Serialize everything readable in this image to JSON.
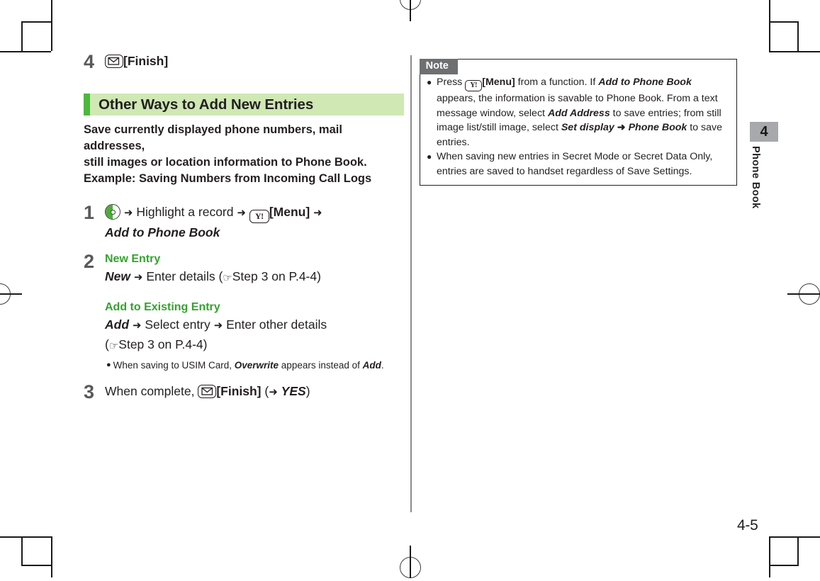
{
  "document": {
    "page_number": "4-5",
    "chapter_number": "4",
    "chapter_name": "Phone Book"
  },
  "left_column": {
    "step_4": {
      "number": "4",
      "key_icon": "mail-key-icon",
      "label": "[Finish]"
    },
    "section": {
      "title": "Other Ways to Add New Entries",
      "accent_color": "#4cb83c",
      "background_color": "#cfe8b4",
      "intro_line_1": "Save currently displayed phone numbers, mail addresses,",
      "intro_line_2": "still images or location information to Phone Book.",
      "intro_line_3": "Example: Saving Numbers from Incoming Call Logs"
    },
    "step_1": {
      "number": "1",
      "nav_icon": "navigation-key-icon",
      "arrow": "➜",
      "text_a": "Highlight a record",
      "menu_key_icon": "y-menu-key-icon",
      "menu_label": "[Menu]",
      "result": "Add to Phone Book"
    },
    "step_2": {
      "number": "2",
      "sub_1": {
        "label": "New Entry",
        "label_color": "#34a32e",
        "command": "New",
        "text": "Enter details",
        "ref_open": "(",
        "ref_icon": "pointing-hand-icon",
        "ref": "Step 3 on P.4-4",
        "ref_close": ")"
      },
      "sub_2": {
        "label": "Add to Existing Entry",
        "label_color": "#34a32e",
        "command": "Add",
        "text_a": "Select entry",
        "text_b": "Enter other details",
        "ref_open": "(",
        "ref_icon": "pointing-hand-icon",
        "ref": "Step 3 on P.4-4",
        "ref_close": ")",
        "bullet": {
          "text_a": "When saving to USIM Card,",
          "emph_a": "Overwrite",
          "text_b": "appears instead of",
          "emph_b": "Add",
          "text_c": "."
        }
      }
    },
    "step_3": {
      "number": "3",
      "text_a": "When complete,",
      "key_icon": "mail-key-icon",
      "label": "[Finish]",
      "paren_open": "(",
      "arrow": "➜",
      "emph": "YES",
      "paren_close": ")"
    }
  },
  "note_box": {
    "header": "Note",
    "header_bg": "#6e6f71",
    "items": [
      {
        "seg_1": "Press",
        "key_icon": "y-menu-key-icon",
        "seg_2": "[Menu]",
        "seg_3": "from a function. If",
        "emph_1": "Add to Phone Book",
        "seg_4": "appears, the information is savable to Phone Book. From a text message window, select",
        "emph_2": "Add Address",
        "seg_5": "to save entries; from still image list/still image, select",
        "emph_3": "Set display",
        "arrow": "➜",
        "emph_4": "Phone Book",
        "seg_6": "to save entries."
      },
      {
        "text": "When saving new entries in Secret Mode or Secret Data Only, entries are saved to handset regardless of Save Settings."
      }
    ]
  }
}
